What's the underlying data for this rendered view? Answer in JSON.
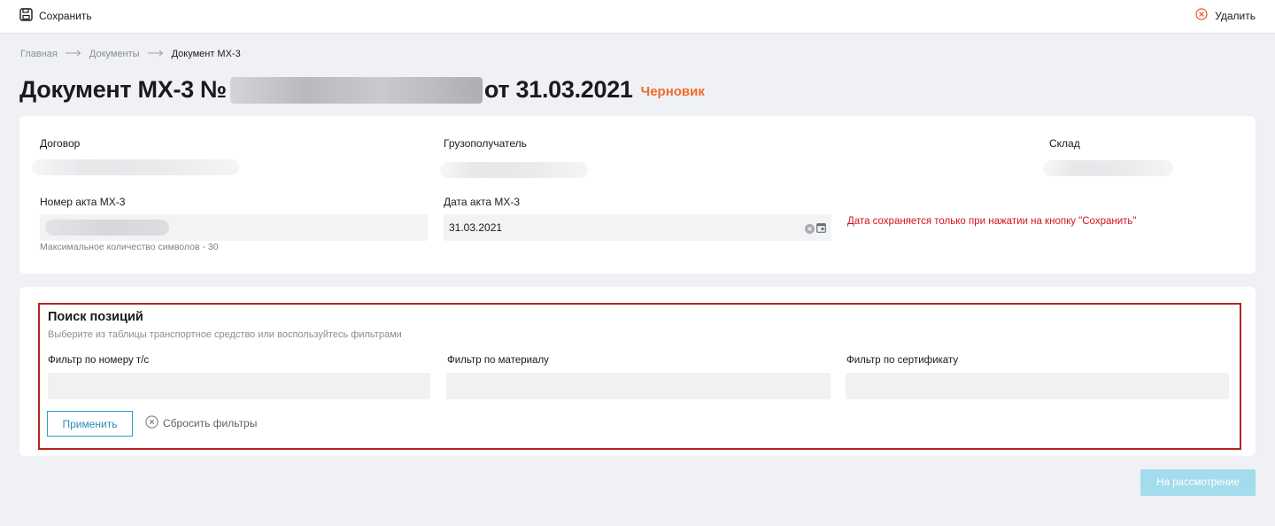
{
  "toolbar": {
    "save_label": "Сохранить",
    "delete_label": "Удалить",
    "save_icon": "floppy-disk-icon",
    "delete_icon": "close-circle-icon",
    "delete_color": "#e8572a"
  },
  "breadcrumb": {
    "items": [
      "Главная",
      "Документы",
      "Документ МХ-3"
    ]
  },
  "header": {
    "title_prefix": "Документ МХ-3 №",
    "title_suffix": "от 31.03.2021",
    "status": "Черновик",
    "status_color": "#ef6a2a"
  },
  "details": {
    "contract_label": "Договор",
    "consignee_label": "Грузополучатель",
    "warehouse_label": "Склад",
    "act_number_label": "Номер акта МХ-3",
    "act_number_hint": "Максимальное количество символов - 30",
    "act_date_label": "Дата акта МХ-3",
    "act_date_value": "31.03.2021",
    "date_warning": "Дата сохраняется только при нажатии на кнопку \"Сохранить\"",
    "warning_color": "#d4121e"
  },
  "search": {
    "title": "Поиск позиций",
    "subtitle": "Выберите из таблицы транспортное средство или воспользуйтесь фильтрами",
    "filter_vehicle_label": "Фильтр по номеру т/с",
    "filter_material_label": "Фильтр по материалу",
    "filter_certificate_label": "Фильтр по сертификату",
    "apply_label": "Применить",
    "reset_label": "Сбросить фильтры",
    "accent_color": "#2a9fc2",
    "border_color": "#b3261e"
  },
  "footer": {
    "review_label": "На рассмотрение",
    "review_color": "#a3dcec"
  }
}
